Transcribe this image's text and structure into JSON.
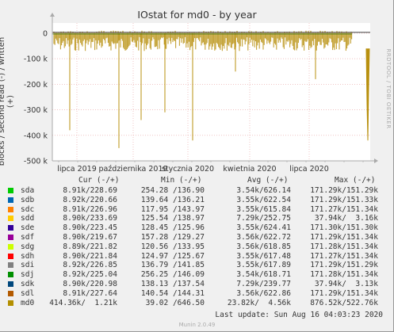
{
  "chart_data": {
    "type": "line",
    "title": "IOstat for md0 - by year",
    "ylabel": "blocks / second read (-) / written (+)",
    "right_label": "RRDTOOL / TOBI OETIKER",
    "x_ticks": [
      "lipca 2019",
      "października 2019",
      "stycznia 2020",
      "kwietnia 2020",
      "lipca 2020"
    ],
    "y_ticks": [
      "0",
      "-100 k",
      "-200 k",
      "-300 k",
      "-400 k",
      "-500 k"
    ],
    "ylim": [
      -500000,
      40000
    ],
    "series_color": "#b8900f",
    "spikes": [
      -380000,
      -450000,
      -340000,
      -310000,
      -420000,
      -150000,
      -180000
    ],
    "tail_min": -420000
  },
  "legend": {
    "headers": [
      "Cur (-/+)",
      "Min (-/+)",
      "Avg (-/+)",
      "Max (-/+)"
    ],
    "rows": [
      {
        "name": "sda",
        "color": "#00cc00",
        "cur": "8.91k/228.69",
        "min": "254.28 /136.90",
        "avg": "3.54k/626.14",
        "max": "171.29k/151.29k"
      },
      {
        "name": "sdb",
        "color": "#0066b3",
        "cur": "8.92k/220.66",
        "min": "139.64 /136.21",
        "avg": "3.55k/622.54",
        "max": "171.29k/151.33k"
      },
      {
        "name": "sdc",
        "color": "#ff8000",
        "cur": "8.91k/226.96",
        "min": "117.95 /143.97",
        "avg": "3.55k/615.84",
        "max": "171.27k/151.34k"
      },
      {
        "name": "sdd",
        "color": "#ffcc00",
        "cur": "8.90k/233.69",
        "min": "125.54 /138.97",
        "avg": "7.29k/252.75",
        "max": "37.94k/  3.16k"
      },
      {
        "name": "sde",
        "color": "#330099",
        "cur": "8.90k/223.45",
        "min": "128.45 /125.96",
        "avg": "3.55k/624.41",
        "max": "171.30k/151.30k"
      },
      {
        "name": "sdf",
        "color": "#990099",
        "cur": "8.90k/219.67",
        "min": "157.28 /129.27",
        "avg": "3.56k/622.72",
        "max": "171.29k/151.34k"
      },
      {
        "name": "sdg",
        "color": "#ccff00",
        "cur": "8.89k/221.82",
        "min": "120.56 /133.95",
        "avg": "3.56k/618.85",
        "max": "171.28k/151.34k"
      },
      {
        "name": "sdh",
        "color": "#ff0000",
        "cur": "8.90k/221.84",
        "min": "124.97 /125.67",
        "avg": "3.55k/617.48",
        "max": "171.27k/151.34k"
      },
      {
        "name": "sdi",
        "color": "#808080",
        "cur": "8.92k/226.85",
        "min": "136.79 /141.85",
        "avg": "3.55k/617.89",
        "max": "171.29k/151.29k"
      },
      {
        "name": "sdj",
        "color": "#008f00",
        "cur": "8.92k/225.04",
        "min": "256.25 /146.09",
        "avg": "3.54k/618.71",
        "max": "171.28k/151.34k"
      },
      {
        "name": "sdk",
        "color": "#00487d",
        "cur": "8.90k/220.98",
        "min": "138.13 /137.54",
        "avg": "7.29k/239.77",
        "max": "37.94k/  3.13k"
      },
      {
        "name": "sdl",
        "color": "#b35a00",
        "cur": "8.91k/227.64",
        "min": "140.54 /144.31",
        "avg": "3.56k/622.86",
        "max": "171.29k/151.34k"
      },
      {
        "name": "md0",
        "color": "#b38f00",
        "cur": "414.36k/  1.21k",
        "min": "39.02 /646.50",
        "avg": "23.82k/  4.56k",
        "max": "876.52k/522.76k"
      }
    ]
  },
  "last_update": "Last update: Sun Aug 16 04:03:23 2020",
  "footer": "Munin 2.0.49"
}
